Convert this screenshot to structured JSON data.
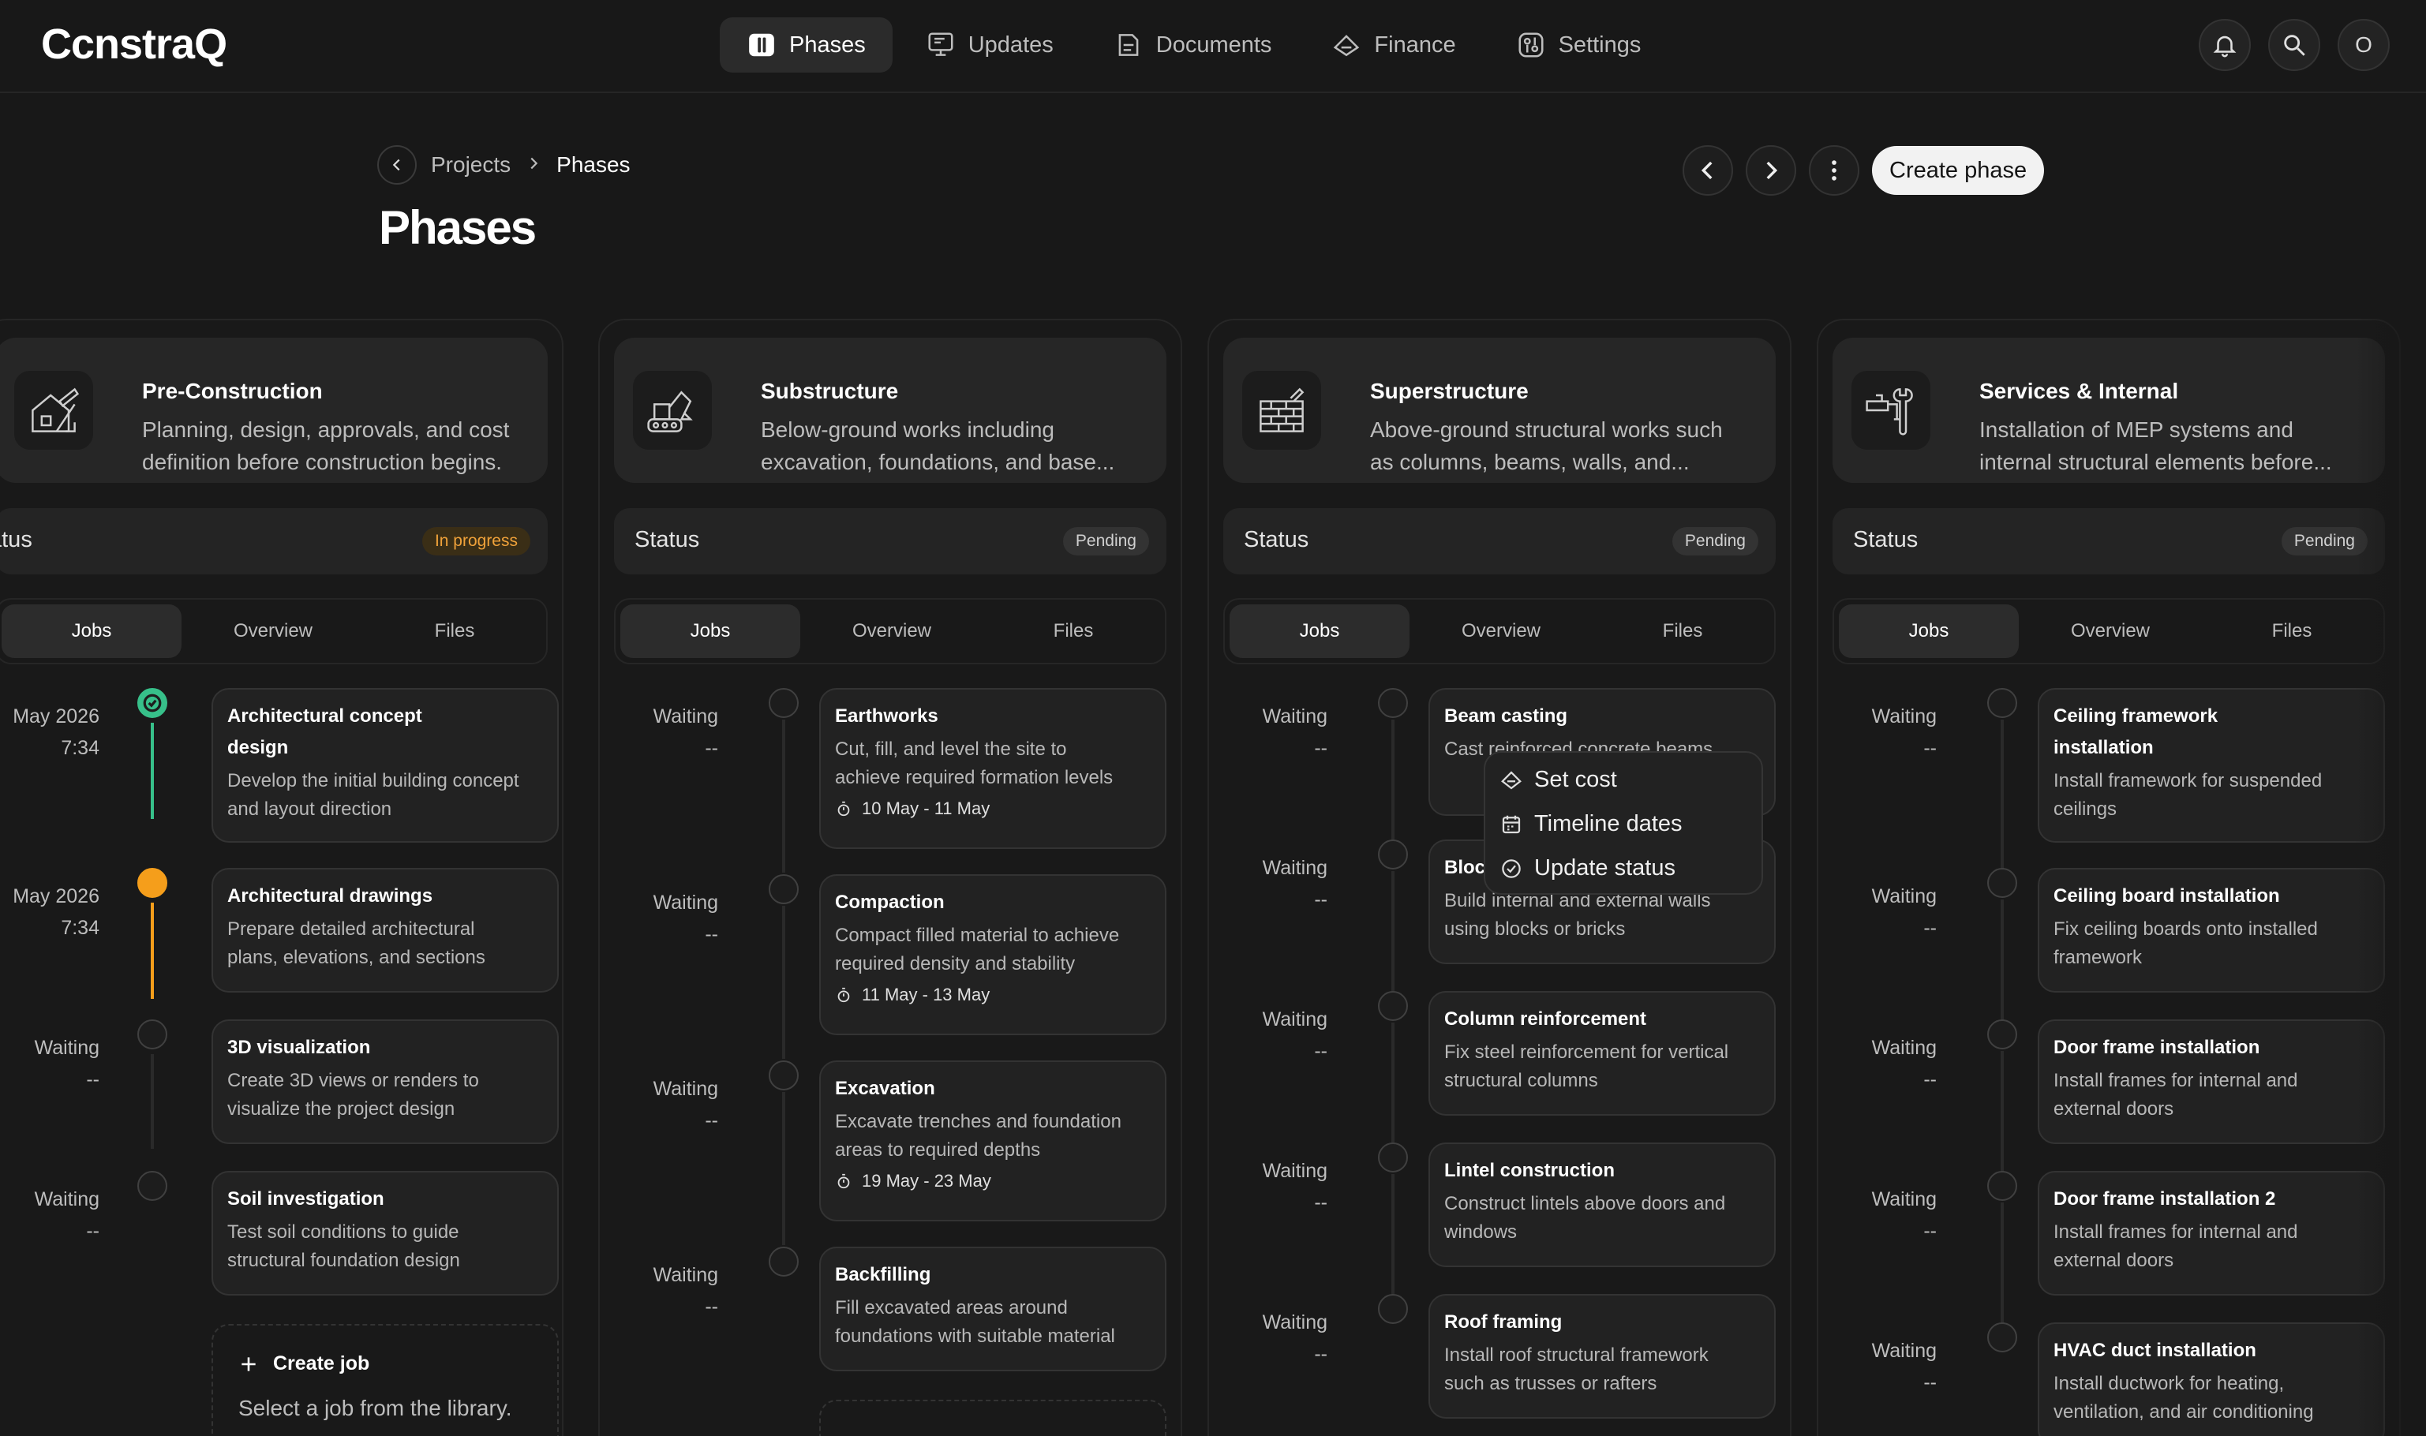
{
  "app": {
    "logo": "CcnstraQ"
  },
  "nav": [
    {
      "label": "Phases",
      "icon": "phases-icon",
      "active": true
    },
    {
      "label": "Updates",
      "icon": "updates-icon"
    },
    {
      "label": "Documents",
      "icon": "documents-icon"
    },
    {
      "label": "Finance",
      "icon": "finance-icon"
    },
    {
      "label": "Settings",
      "icon": "settings-icon"
    }
  ],
  "user": {
    "avatar_initial": "O"
  },
  "breadcrumb": {
    "parent": "Projects",
    "current": "Phases"
  },
  "page": {
    "title": "Phases",
    "create_label": "Create phase"
  },
  "tabs_labels": {
    "jobs": "Jobs",
    "overview": "Overview",
    "files": "Files"
  },
  "status_label": "Status",
  "phases": [
    {
      "name": "Pre-Construction",
      "desc_line1": "Planning, design, approvals, and cost",
      "desc_line2": "definition before construction begins.",
      "status_label": "atus",
      "status": "In progress",
      "icon": "blueprint-house-icon",
      "jobs": [
        {
          "when1": "May 2026",
          "when2": "7:34",
          "state": "done",
          "title1": "Architectural concept",
          "title2": "design",
          "desc1": "Develop the initial building concept",
          "desc2": "and layout direction"
        },
        {
          "when1": "May 2026",
          "when2": "7:34",
          "state": "active",
          "title1": "Architectural drawings",
          "desc1": "Prepare detailed architectural",
          "desc2": "plans, elevations, and sections"
        },
        {
          "when1": "Waiting",
          "when2": "--",
          "state": "waiting",
          "title1": "3D visualization",
          "desc1": "Create 3D views or renders to",
          "desc2": "visualize the project design"
        },
        {
          "when1": "Waiting",
          "when2": "--",
          "state": "waiting",
          "title1": "Soil investigation",
          "desc1": "Test soil conditions to guide",
          "desc2": "structural foundation design"
        }
      ],
      "create_job": {
        "title": "Create job",
        "sub": "Select a job from the library."
      }
    },
    {
      "name": "Substructure",
      "desc_line1": "Below-ground works including",
      "desc_line2": "excavation, foundations, and base...",
      "status_label": "Status",
      "status": "Pending",
      "icon": "excavator-icon",
      "jobs": [
        {
          "when1": "Waiting",
          "when2": "--",
          "title1": "Earthworks",
          "desc1": "Cut, fill, and level the site to",
          "desc2": "achieve required formation levels",
          "date": "10 May - 11 May"
        },
        {
          "when1": "Waiting",
          "when2": "--",
          "title1": "Compaction",
          "desc1": "Compact filled material to achieve",
          "desc2": "required density and stability",
          "date": "11 May - 13 May"
        },
        {
          "when1": "Waiting",
          "when2": "--",
          "title1": "Excavation",
          "desc1": "Excavate trenches and foundation",
          "desc2": "areas to required depths",
          "date": "19 May - 23 May"
        },
        {
          "when1": "Waiting",
          "when2": "--",
          "title1": "Backfilling",
          "desc1": "Fill excavated areas around",
          "desc2": "foundations with suitable material"
        }
      ]
    },
    {
      "name": "Superstructure",
      "desc_line1": "Above-ground structural works such",
      "desc_line2": "as columns, beams, walls, and...",
      "status_label": "Status",
      "status": "Pending",
      "icon": "brick-wall-icon",
      "jobs": [
        {
          "when1": "Waiting",
          "when2": "--",
          "title1": "Beam casting",
          "desc1": "Cast reinforced concrete beams"
        },
        {
          "when1": "Waiting",
          "when2": "--",
          "title1": "Block",
          "desc1": "Build internal and external walls",
          "desc2": "using blocks or bricks"
        },
        {
          "when1": "Waiting",
          "when2": "--",
          "title1": "Column reinforcement",
          "desc1": "Fix steel reinforcement for vertical",
          "desc2": "structural columns"
        },
        {
          "when1": "Waiting",
          "when2": "--",
          "title1": "Lintel construction",
          "desc1": "Construct lintels above doors and",
          "desc2": "windows"
        },
        {
          "when1": "Waiting",
          "when2": "--",
          "title1": "Roof framing",
          "desc1": "Install roof structural framework",
          "desc2": "such as trusses or rafters"
        }
      ]
    },
    {
      "name": "Services & Internal",
      "desc_line1": "Installation of MEP systems and",
      "desc_line2": "internal structural elements before...",
      "status_label": "Status",
      "status": "Pending",
      "icon": "tap-wrench-icon",
      "jobs": [
        {
          "when1": "Waiting",
          "when2": "--",
          "title1": "Ceiling framework",
          "title2": "installation",
          "desc1": "Install framework for suspended",
          "desc2": "ceilings"
        },
        {
          "when1": "Waiting",
          "when2": "--",
          "title1": "Ceiling board installation",
          "desc1": "Fix ceiling boards onto installed",
          "desc2": "framework"
        },
        {
          "when1": "Waiting",
          "when2": "--",
          "title1": "Door frame installation",
          "desc1": "Install frames for internal and",
          "desc2": "external doors"
        },
        {
          "when1": "Waiting",
          "when2": "--",
          "title1": "Door frame installation 2",
          "desc1": "Install frames for internal and",
          "desc2": "external doors"
        },
        {
          "when1": "Waiting",
          "when2": "--",
          "title1": "HVAC duct installation",
          "desc1": "Install ductwork for heating,",
          "desc2": "ventilation, and air conditioning"
        }
      ]
    }
  ],
  "context_menu": [
    {
      "label": "Set cost",
      "icon": "tag-icon"
    },
    {
      "label": "Timeline dates",
      "icon": "calendar-icon"
    },
    {
      "label": "Update status",
      "icon": "check-circle-icon"
    }
  ],
  "colors": {
    "done": "#37c08a",
    "active": "#f59e1b",
    "accent_badge": "#f0a23a"
  }
}
